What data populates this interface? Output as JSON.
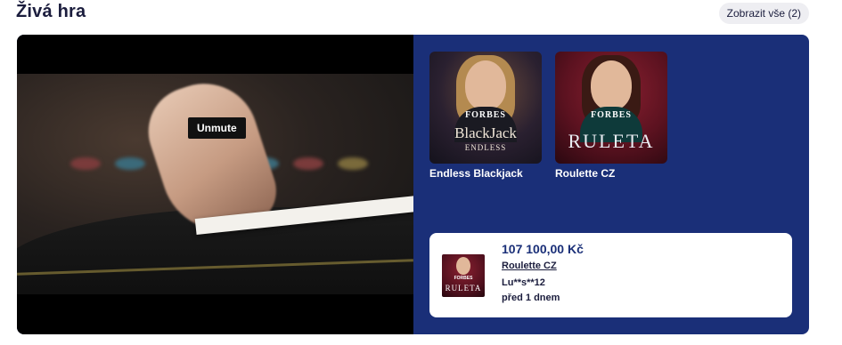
{
  "section": {
    "title": "Živá hra",
    "view_all_label": "Zobrazit vše (2)"
  },
  "video": {
    "unmute_label": "Unmute"
  },
  "games": [
    {
      "title": "Endless Blackjack",
      "thumb_brand": "FORBES",
      "thumb_name": "BlackJack",
      "thumb_sub": "ENDLESS"
    },
    {
      "title": "Roulette CZ",
      "thumb_brand": "FORBES",
      "thumb_name": "RULETA"
    }
  ],
  "recent_win": {
    "amount": "107 100,00 Kč",
    "game": "Roulette CZ",
    "user": "Lu**s**12",
    "time": "před 1 dnem",
    "thumb_brand": "FORBES",
    "thumb_name": "RULETA"
  },
  "colors": {
    "panel_bg": "#1a2f78",
    "card_bg": "#ffffff",
    "title_text": "#1b1d3d"
  }
}
